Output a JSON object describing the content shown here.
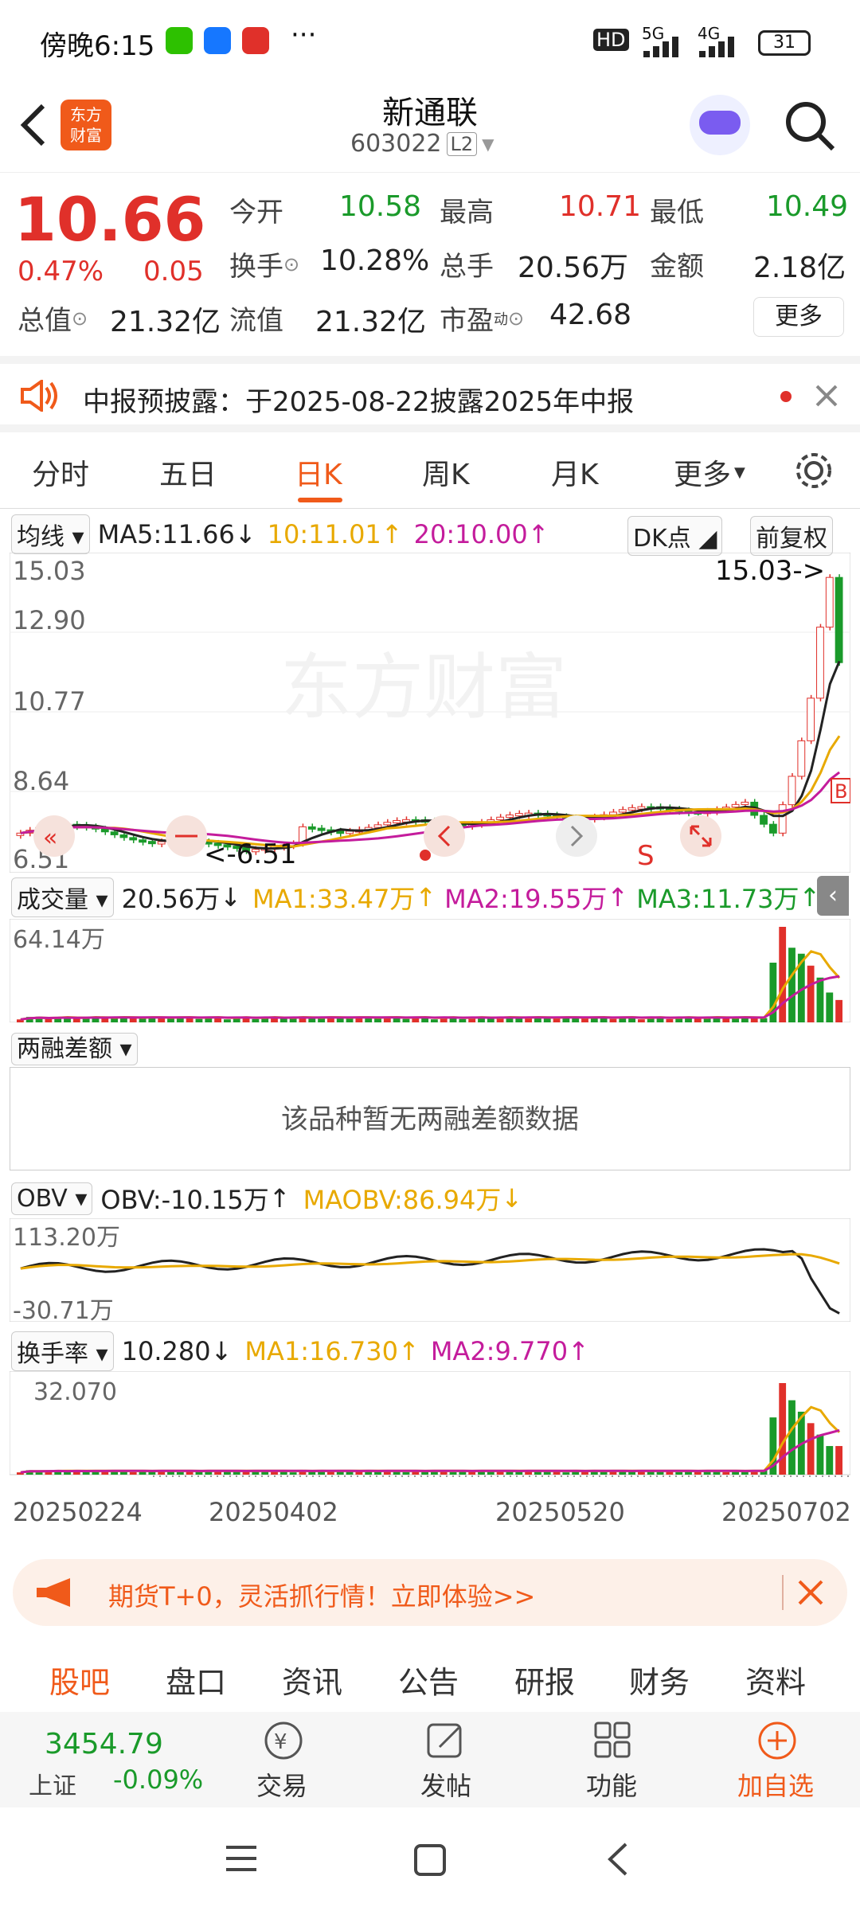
{
  "status": {
    "time": "傍晚6:15",
    "battery": "31",
    "net1": "5G",
    "net2": "4G",
    "hd": "HD"
  },
  "header": {
    "title": "新通联",
    "code": "603022",
    "level": "L2",
    "logo_line1": "东方",
    "logo_line2": "财富"
  },
  "quote": {
    "price": "10.66",
    "change_pct": "0.47%",
    "change": "0.05",
    "open_label": "今开",
    "open": "10.58",
    "high_label": "最高",
    "high": "10.71",
    "low_label": "最低",
    "low": "10.49",
    "turnover_label": "换手",
    "turnover": "10.28%",
    "vol_label": "总手",
    "vol": "20.56万",
    "amount_label": "金额",
    "amount": "2.18亿",
    "mcap_label": "总值",
    "mcap": "21.32亿",
    "float_label": "流值",
    "float": "21.32亿",
    "pe_label": "市盈",
    "pe_sup": "动",
    "pe": "42.68",
    "more": "更多"
  },
  "notice": {
    "text": "中报预披露：于2025-08-22披露2025年中报"
  },
  "tabs": [
    "分时",
    "五日",
    "日K",
    "周K",
    "月K",
    "更多"
  ],
  "main_chart": {
    "ma_select": "均线",
    "ma5": "MA5:11.66",
    "ma10": "10:11.01",
    "ma20": "20:10.00",
    "dk": "DK点",
    "adjust": "前复权",
    "y_labels": [
      "15.03",
      "12.90",
      "10.77",
      "8.64",
      "6.51"
    ],
    "max_label": "15.03->",
    "min_label": "<-6.51",
    "watermark": "东方财富",
    "s_mark": "S",
    "b_mark": "B"
  },
  "volume": {
    "select": "成交量",
    "value": "20.56万",
    "ma1": "MA1:33.47万",
    "ma2": "MA2:19.55万",
    "ma3": "MA3:11.73万",
    "y_max": "64.14万"
  },
  "margin": {
    "select": "两融差额",
    "empty": "该品种暂无两融差额数据"
  },
  "obv": {
    "select": "OBV",
    "value": "OBV:-10.15万",
    "ma": "MAOBV:86.94万",
    "y_top": "113.20万",
    "y_bottom": "-30.71万"
  },
  "turnover": {
    "select": "换手率",
    "value": "10.280",
    "ma1": "MA1:16.730",
    "ma2": "MA2:9.770",
    "y_max": "32.070"
  },
  "dates": [
    "20250224",
    "20250402",
    "20250520",
    "20250702"
  ],
  "promo": {
    "text": "期货T+0，灵活抓行情！立即体验>>"
  },
  "subtabs": [
    "股吧",
    "盘口",
    "资讯",
    "公告",
    "研报",
    "财务",
    "资料"
  ],
  "bottom": {
    "index_value": "3454.79",
    "index_name": "上证",
    "index_change": "-0.09%",
    "trade": "交易",
    "post": "发帖",
    "func": "功能",
    "add": "加自选"
  }
}
